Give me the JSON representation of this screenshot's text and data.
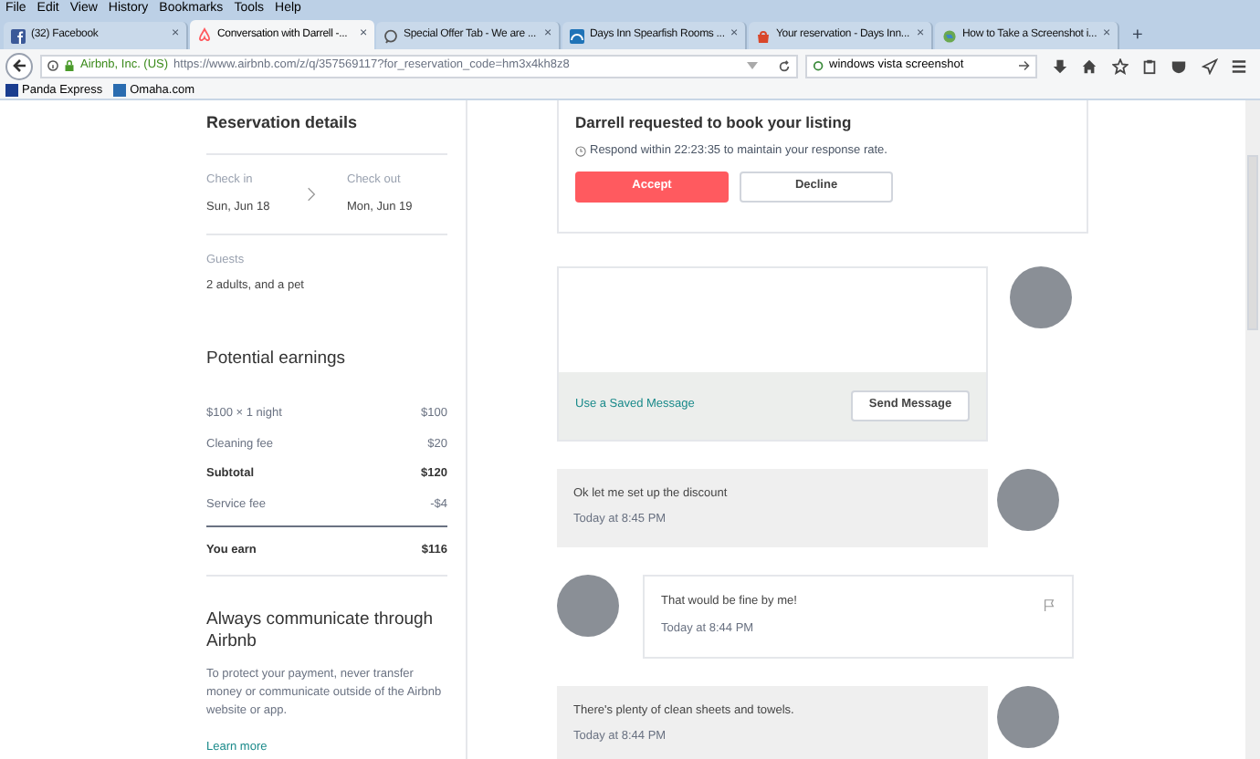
{
  "menu_bar": [
    "File",
    "Edit",
    "View",
    "History",
    "Bookmarks",
    "Tools",
    "Help"
  ],
  "tabs": [
    {
      "label": "(32) Facebook",
      "selected": false,
      "kind": "facebook"
    },
    {
      "label": "Conversation with Darrell -...",
      "selected": true,
      "kind": "airbnb"
    },
    {
      "label": "Special Offer Tab - We are ...",
      "selected": false,
      "kind": "chat"
    },
    {
      "label": "Days Inn Spearfish Rooms ...",
      "selected": false,
      "kind": "daysinn"
    },
    {
      "label": "Your reservation - Days Inn...",
      "selected": false,
      "kind": "bag"
    },
    {
      "label": "How to Take a Screenshot i...",
      "selected": false,
      "kind": "globe"
    }
  ],
  "tab_close": "×",
  "new_tab": "+",
  "nav_bar": {
    "identity": "Airbnb, Inc. (US)",
    "url": "https://www.airbnb.com/z/q/357569117?for_reservation_code=hm3x4kh8z8",
    "search": "windows vista screenshot"
  },
  "bookmarks": [
    "Panda Express",
    "Omaha.com"
  ],
  "reservation": {
    "title": "Reservation details",
    "check_in_label": "Check in",
    "check_in": "Sun, Jun 18",
    "check_out_label": "Check out",
    "check_out": "Mon, Jun 19",
    "guests_label": "Guests",
    "guests": "2 adults, and a pet"
  },
  "earnings": {
    "title": "Potential earnings",
    "rows": [
      {
        "label": "$100 × 1 night",
        "amount": "$100",
        "kind": "line"
      },
      {
        "label": "Cleaning fee",
        "amount": "$20",
        "kind": "line"
      },
      {
        "label": "Subtotal",
        "amount": "$120",
        "kind": "subtotal"
      },
      {
        "label": "Service fee",
        "amount": "-$4",
        "kind": "line"
      },
      {
        "label": "You earn",
        "amount": "$116",
        "kind": "total"
      }
    ]
  },
  "notice": {
    "title": "Always communicate through Airbnb",
    "text": "To protect your payment, never transfer money or communicate outside of the Airbnb website or app.",
    "link": "Learn more"
  },
  "request": {
    "title": "Darrell requested to book your listing",
    "respond": "Respond within 22:23:35 to maintain your response rate.",
    "accept": "Accept",
    "decline": "Decline"
  },
  "composer": {
    "link": "Use a Saved Message",
    "button": "Send Message"
  },
  "messages": [
    {
      "kind": "self",
      "text": "Ok let me set up the discount",
      "time": "Today at 8:45 PM"
    },
    {
      "kind": "other",
      "text": "That would be fine by me!",
      "time": "Today at 8:44 PM"
    },
    {
      "kind": "self",
      "text": "There's plenty of clean sheets and towels.",
      "time": "Today at 8:44 PM"
    }
  ]
}
